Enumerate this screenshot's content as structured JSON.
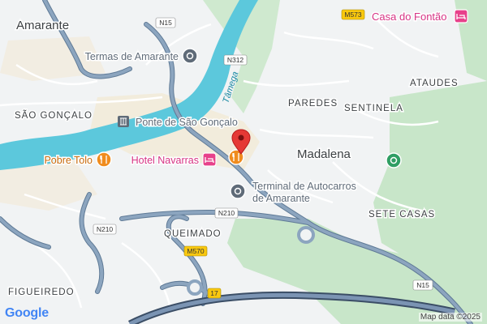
{
  "map": {
    "places": {
      "amarante": "Amarante",
      "sao_goncalo": "SÃO GONÇALO",
      "paredes": "PAREDES",
      "sentinela": "SENTINELA",
      "ataudes": "ATAUDES",
      "madalena": "Madalena",
      "sete_casas": "SETE CASAS",
      "queimado": "QUEIMADO",
      "figueiredo": "FIGUEIREDO"
    },
    "pois": {
      "termas": "Termas de Amarante",
      "ponte": "Ponte de São Gonçalo",
      "pobre_tolo": "Pobre Tolo",
      "hotel_navarras": "Hotel Navarras",
      "casa_fontao": "Casa do Fontão",
      "terminal_line1": "Terminal de Autocarros",
      "terminal_line2": "de Amarante"
    },
    "river": "Tâmega",
    "roads": {
      "n15_top": "N15",
      "n312": "N312",
      "m573": "M573",
      "n210_left": "N210",
      "n210_mid": "N210",
      "m570": "M570",
      "a4": "17",
      "n15_bottom": "N15"
    },
    "colors": {
      "water": "#5cc8dc",
      "park": "#c8e6c9",
      "road": "#8ca5bf",
      "road_outline": "#5f7a96",
      "restaurant": "#f08c1e",
      "hotel": "#e7418a",
      "attraction": "#5f6b78",
      "park_poi": "#2f9e63",
      "pin": "#e53935"
    },
    "logo": "Google",
    "attribution": "Map data ©2025"
  }
}
